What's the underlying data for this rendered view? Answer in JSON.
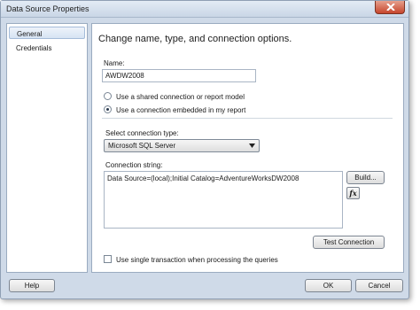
{
  "window": {
    "title": "Data Source Properties"
  },
  "sidebar": {
    "items": [
      {
        "label": "General",
        "selected": true
      },
      {
        "label": "Credentials",
        "selected": false
      }
    ]
  },
  "main": {
    "heading": "Change name, type, and connection options.",
    "name_label": "Name:",
    "name_value": "AWDW2008",
    "radio_shared": {
      "label": "Use a shared connection or report model",
      "checked": false
    },
    "radio_embedded": {
      "label": "Use a connection embedded in my report",
      "checked": true
    },
    "connection_type_label": "Select connection type:",
    "connection_type_value": "Microsoft SQL Server",
    "connection_string_label": "Connection string:",
    "connection_string_value": "Data Source=(local);Initial Catalog=AdventureWorksDW2008",
    "build_button": "Build...",
    "fx_button": "fx",
    "test_connection_button": "Test Connection",
    "single_transaction": {
      "label": "Use single transaction when processing the queries",
      "checked": false
    }
  },
  "footer": {
    "help_button": "Help",
    "ok_button": "OK",
    "cancel_button": "Cancel"
  }
}
